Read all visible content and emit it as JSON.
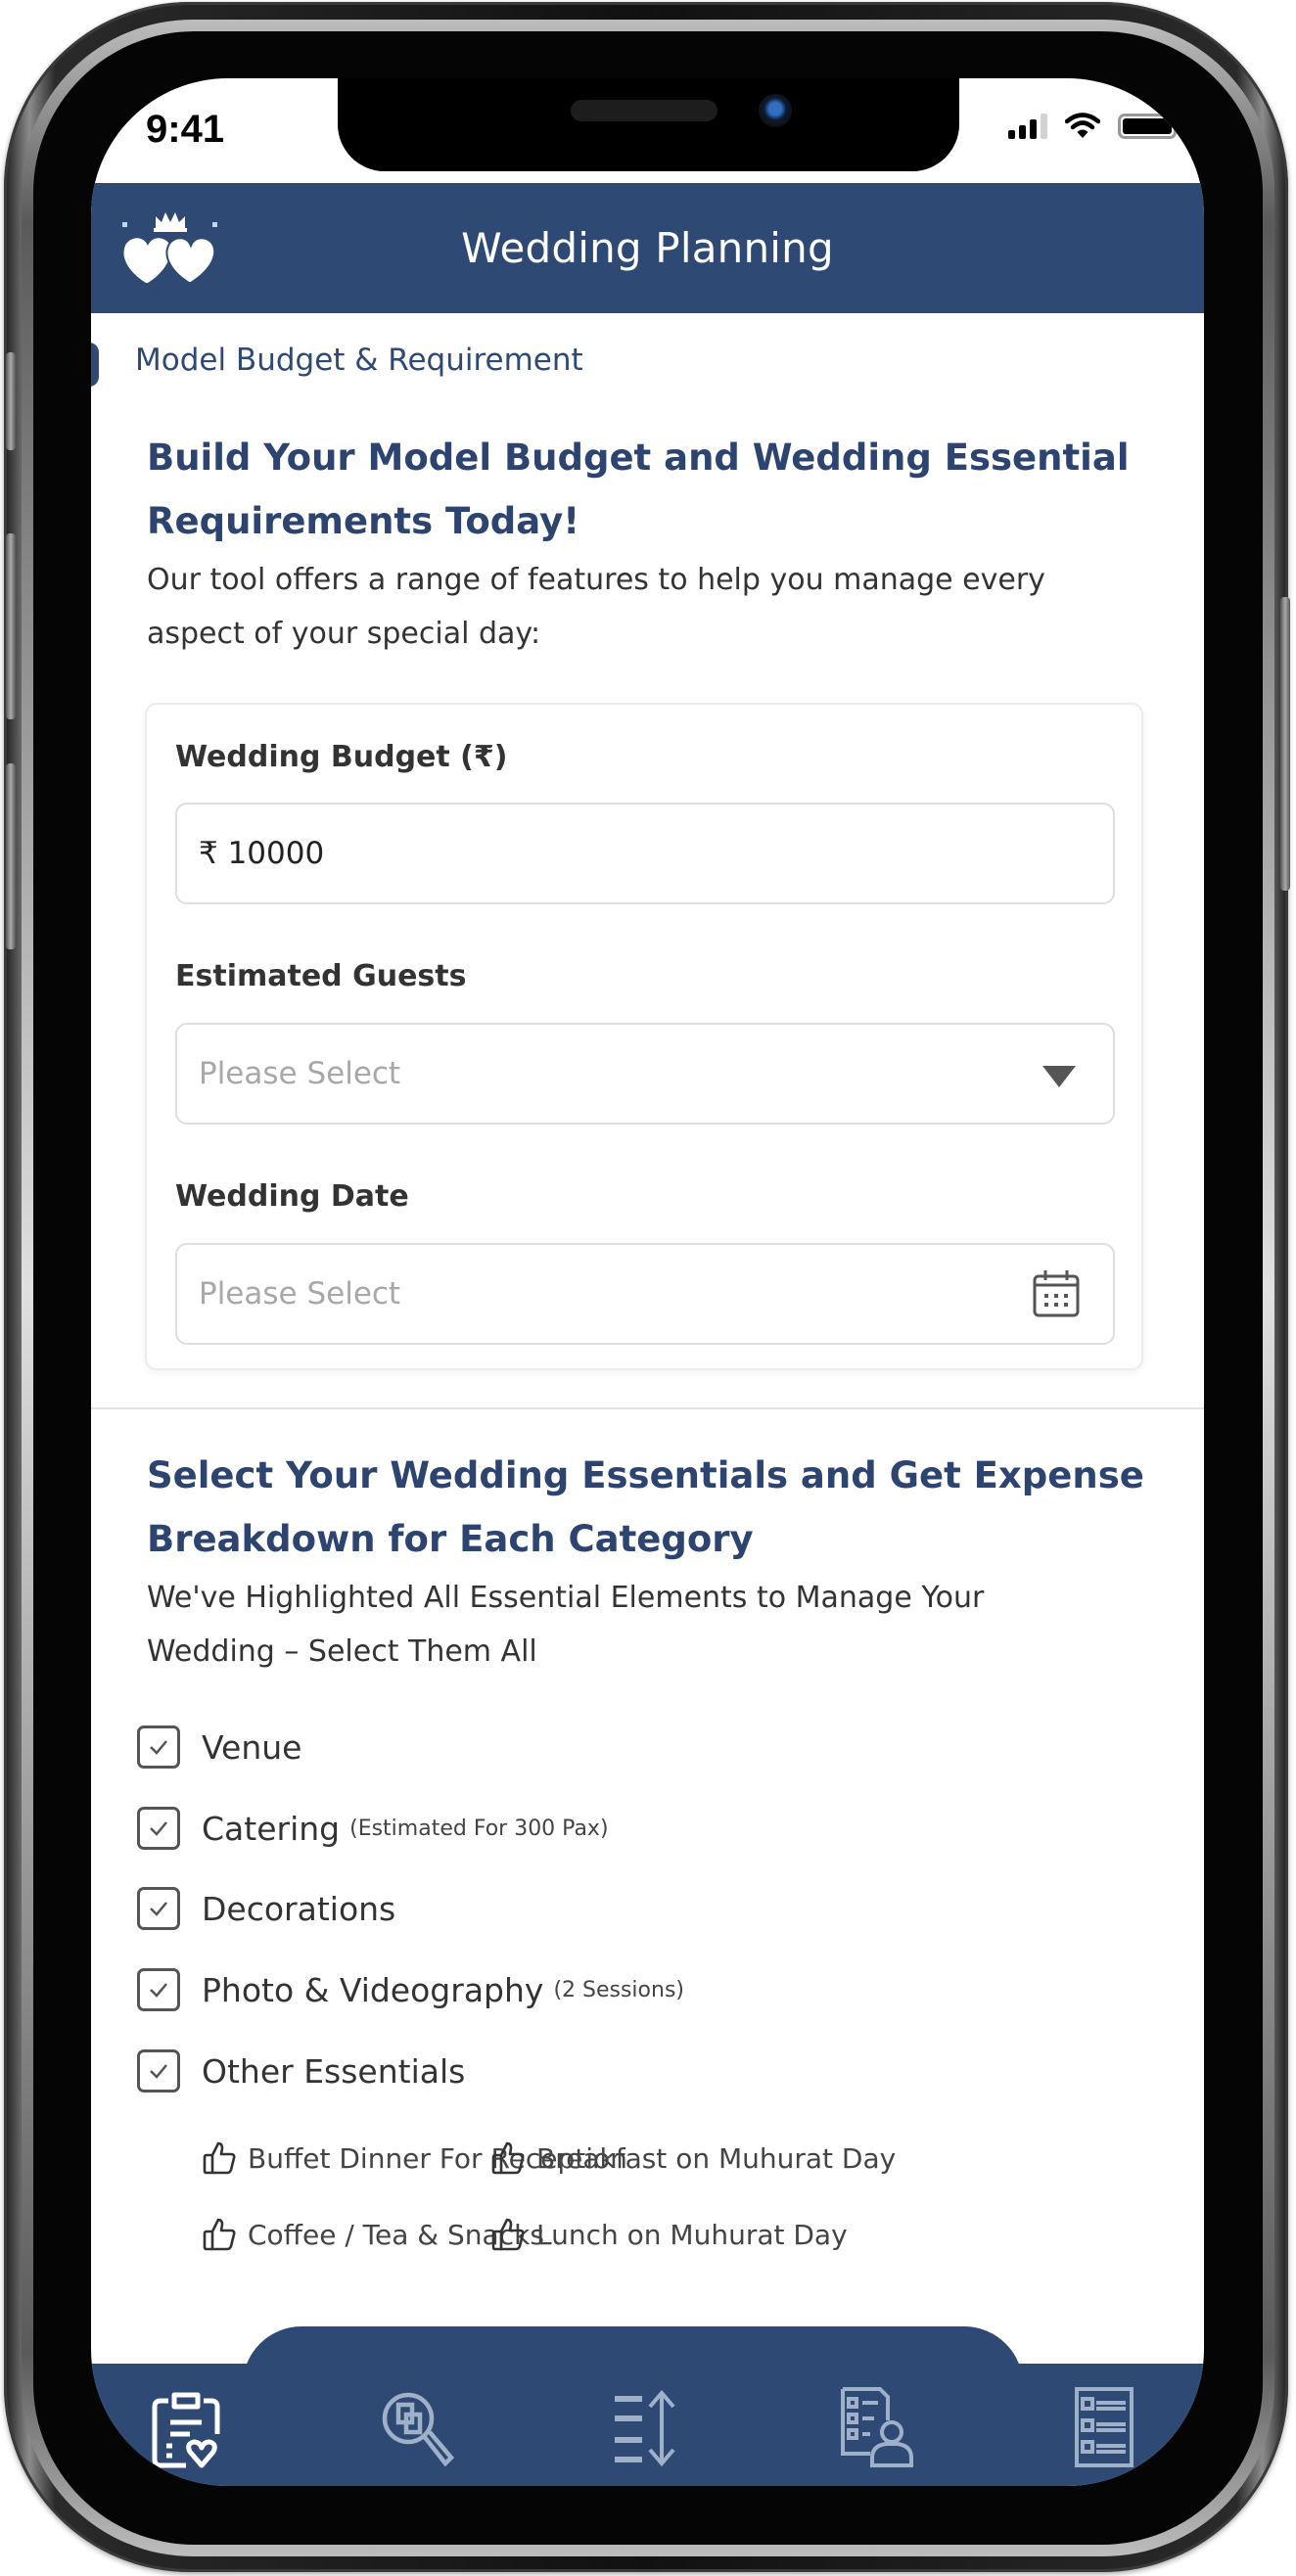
{
  "status_bar": {
    "time": "9:41"
  },
  "header": {
    "title": "Wedding Planning",
    "logo_icon": "crowned-hearts-logo"
  },
  "section": {
    "label": "Model Budget & Requirement"
  },
  "intro": {
    "heading_line1": "Build Your Model Budget and Wedding Essential",
    "heading_line2": "Requirements Today!",
    "desc_line1": "Our tool offers a range of features to help you manage every",
    "desc_line2": "aspect of your special day:"
  },
  "form": {
    "budget": {
      "label": "Wedding Budget (₹)",
      "value": "₹ 10000"
    },
    "guests": {
      "label": "Estimated Guests",
      "placeholder": "Please Select",
      "icon": "caret-down-icon"
    },
    "date": {
      "label": "Wedding Date",
      "placeholder": "Please Select",
      "icon": "calendar-icon"
    }
  },
  "essentials": {
    "heading_line1": "Select Your Wedding Essentials and Get Expense",
    "heading_line2": "Breakdown for Each Category",
    "desc_line1": "We've Highlighted All Essential Elements to Manage Your",
    "desc_line2": "Wedding – Select Them All",
    "items": [
      {
        "label": "Venue",
        "note": "",
        "checked": true
      },
      {
        "label": "Catering",
        "note": "(Estimated For 300 Pax)",
        "checked": true
      },
      {
        "label": "Decorations",
        "note": "",
        "checked": true
      },
      {
        "label": "Photo & Videography",
        "note": "(2 Sessions)",
        "checked": true
      },
      {
        "label": "Other Essentials",
        "note": "",
        "checked": true
      }
    ],
    "other_items": [
      "Buffet Dinner For Reception",
      "Breakfast on Muhurat Day",
      "Coffee / Tea & Snacks",
      "Lunch on Muhurat Day"
    ]
  },
  "bottom_nav": {
    "items": [
      {
        "icon": "clipboard-heart-icon",
        "active": true
      },
      {
        "icon": "search-compare-icon",
        "active": false
      },
      {
        "icon": "sort-list-icon",
        "active": false
      },
      {
        "icon": "checklist-person-icon",
        "active": false
      },
      {
        "icon": "checklist-icon",
        "active": false
      }
    ]
  },
  "colors": {
    "primary": "#2e4a74",
    "heading": "#2d4470",
    "text": "#333333",
    "placeholder": "#a8a8a8",
    "nav_inactive": "#9fb0c9"
  }
}
